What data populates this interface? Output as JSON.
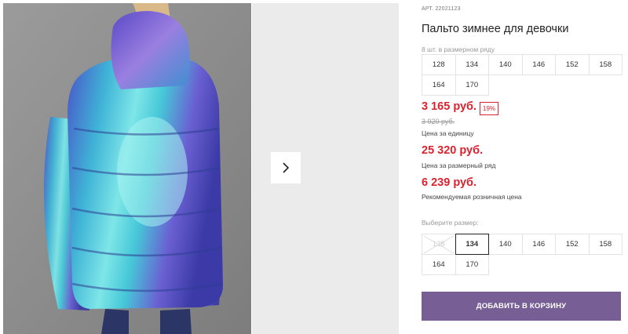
{
  "product": {
    "sku_label": "АРТ.",
    "sku": "22021123",
    "title": "Пальто зимнее для девочки"
  },
  "size_run": {
    "hint": "8 шт. в размерном ряду",
    "sizes": [
      "128",
      "134",
      "140",
      "146",
      "152",
      "158",
      "164",
      "170"
    ]
  },
  "pricing": {
    "unit_price": "3 165 руб.",
    "discount": "19%",
    "old_price": "3 920 руб.",
    "unit_caption": "Цена за единицу",
    "run_price": "25 320 руб.",
    "run_caption": "Цена за размерный ряд",
    "retail_price": "6 239 руб.",
    "retail_caption": "Рекомендуемая розничная цена"
  },
  "size_select": {
    "hint": "Выберите размер:",
    "options": [
      "128",
      "134",
      "140",
      "146",
      "152",
      "158",
      "164",
      "170"
    ],
    "selected": "134",
    "disabled": [
      "128"
    ]
  },
  "actions": {
    "add_to_cart": "ДОБАВИТЬ В КОРЗИНУ"
  },
  "colors": {
    "price_red": "#d9232e",
    "button_purple": "#775f96"
  },
  "icons": {
    "next": "chevron-right-icon"
  }
}
